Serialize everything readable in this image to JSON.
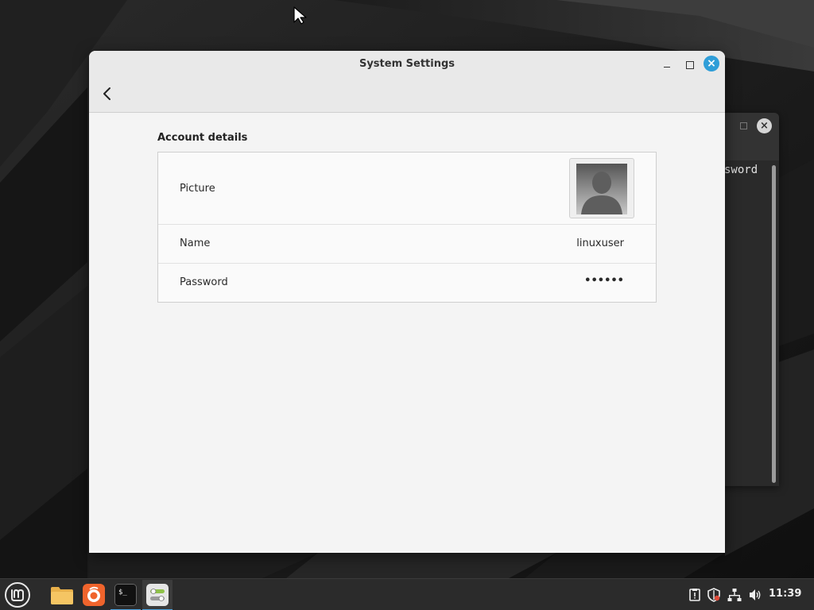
{
  "window": {
    "title": "System Settings"
  },
  "account": {
    "section_title": "Account details",
    "rows": [
      {
        "label": "Picture"
      },
      {
        "label": "Name",
        "value": "linuxuser"
      },
      {
        "label": "Password",
        "value": "••••••"
      }
    ]
  },
  "terminal": {
    "visible_text": "sword"
  },
  "taskbar": {
    "launchers": [
      "files-icon",
      "firefox-icon",
      "terminal-icon",
      "settings-icon"
    ],
    "tray_icons": [
      "update-manager-icon",
      "shield-icon",
      "network-icon",
      "volume-icon"
    ],
    "clock": "11:39"
  },
  "colors": {
    "accent": "#2f9ed8",
    "panel_bg": "#2b2b2b",
    "window_bg": "#f4f4f4"
  }
}
